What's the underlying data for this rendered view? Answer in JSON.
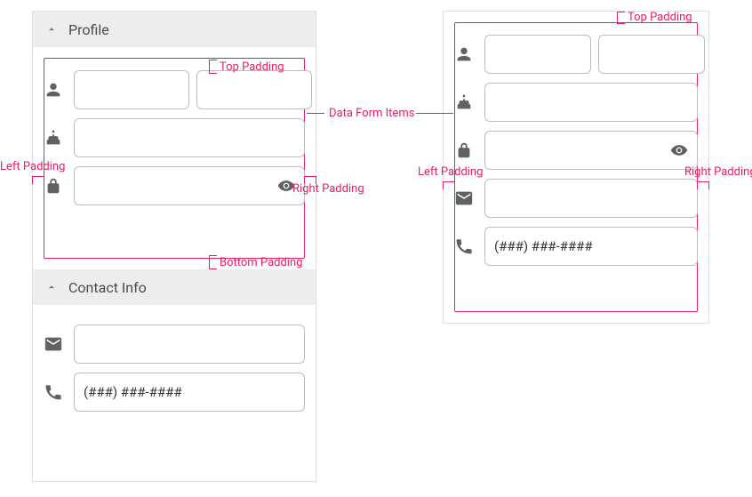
{
  "left_panel": {
    "sections": {
      "profile": {
        "title": "Profile"
      },
      "contact": {
        "title": "Contact Info"
      }
    },
    "phone_mask": "(###) ###-####"
  },
  "right_panel": {
    "phone_mask": "(###) ###-####"
  },
  "annotations": {
    "top_padding_left": "Top Padding",
    "bottom_padding_left": "Bottom Padding",
    "left_padding_left": "Left Padding",
    "right_padding_left": "Right Padding",
    "data_form_items": "Data Form Items",
    "top_padding_right": "Top Padding",
    "left_padding_right": "Left Padding",
    "right_padding_right": "Right Padding"
  },
  "colors": {
    "annotation": "#e91e63",
    "border": "#bdbdbd",
    "header_bg": "#ededed",
    "icon": "#616161"
  }
}
